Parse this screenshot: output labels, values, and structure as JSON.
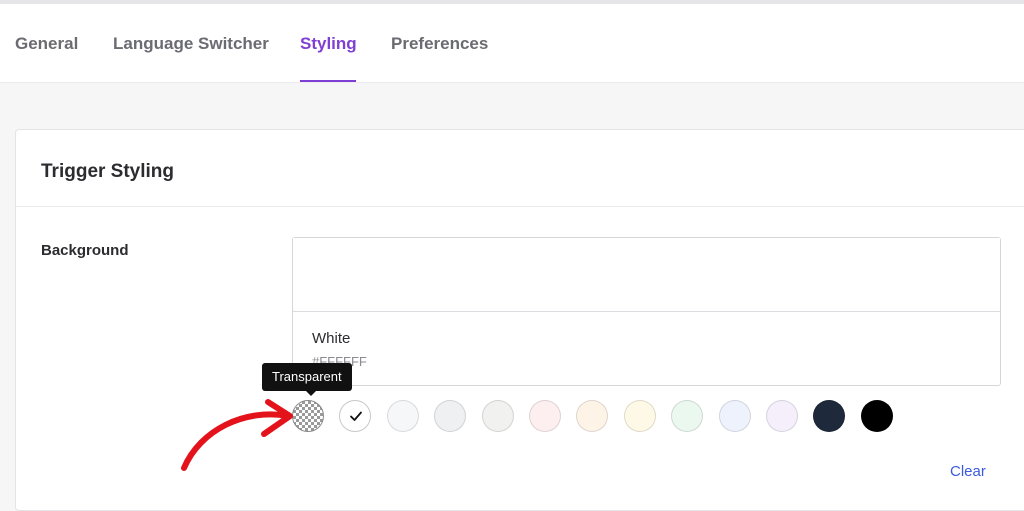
{
  "tabs": [
    {
      "label": "General",
      "active": false
    },
    {
      "label": "Language Switcher",
      "active": false
    },
    {
      "label": "Styling",
      "active": true
    },
    {
      "label": "Preferences",
      "active": false
    }
  ],
  "colors": {
    "accent": "#7f3fd4",
    "link": "#3b5bdb",
    "annotation_arrow": "#e3121b"
  },
  "section": {
    "title": "Trigger Styling",
    "field_label": "Background",
    "current_color": {
      "name": "White",
      "hex": "#FFFFFF"
    },
    "tooltip": "Transparent",
    "clear_label": "Clear",
    "swatches": [
      {
        "name": "transparent",
        "color": "transparent",
        "selected": false
      },
      {
        "name": "white",
        "color": "#ffffff",
        "selected": true
      },
      {
        "name": "gray-50",
        "color": "#f6f7f9",
        "selected": false
      },
      {
        "name": "gray-100",
        "color": "#eef0f2",
        "selected": false
      },
      {
        "name": "gray-warm-100",
        "color": "#f1f1ef",
        "selected": false
      },
      {
        "name": "red-50",
        "color": "#fdeef0",
        "selected": false
      },
      {
        "name": "orange-50",
        "color": "#fdf3e7",
        "selected": false
      },
      {
        "name": "yellow-50",
        "color": "#fdf9e6",
        "selected": false
      },
      {
        "name": "green-50",
        "color": "#eaf8ef",
        "selected": false
      },
      {
        "name": "blue-50",
        "color": "#edf2fc",
        "selected": false
      },
      {
        "name": "purple-50",
        "color": "#f4effa",
        "selected": false
      },
      {
        "name": "navy",
        "color": "#1e293b",
        "selected": false
      },
      {
        "name": "black",
        "color": "#000000",
        "selected": false
      }
    ]
  }
}
